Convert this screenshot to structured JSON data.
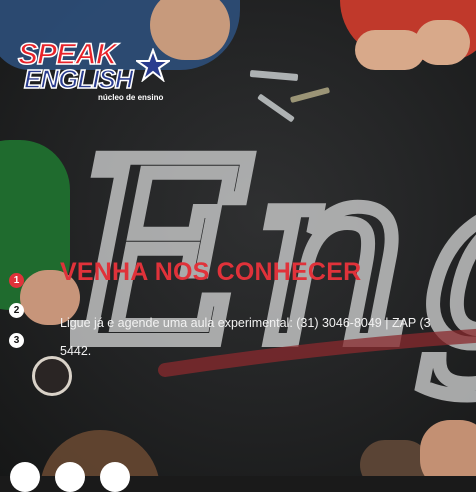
{
  "logo": {
    "speak": "SPEAK",
    "english": "ENGLISH",
    "subtitle": "núcleo de ensino"
  },
  "chalkboard": {
    "word": "Engli"
  },
  "slide": {
    "title": "VENHA NOS CONHECER",
    "description_line1": "Ligue já e agende uma aula experimental: (31) 3046-8049 | ZAP (3",
    "description_line2": "5442."
  },
  "pagination": {
    "items": [
      "1",
      "2",
      "3"
    ],
    "active": 1
  },
  "colors": {
    "accent": "#e0323a",
    "logo_red": "#e8232a",
    "logo_blue": "#2a3c8f"
  }
}
